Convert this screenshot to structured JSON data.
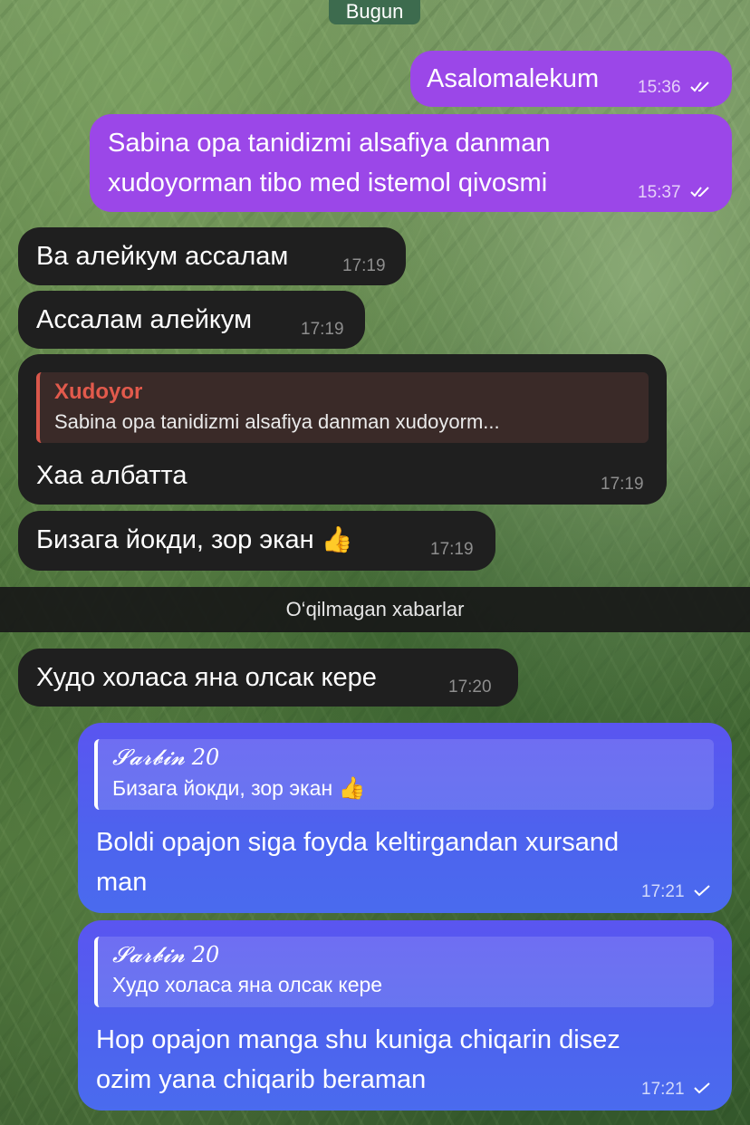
{
  "date_divider": "Bugun",
  "unread_divider": "O‘qilmagan xabarlar",
  "messages": [
    {
      "text": "Asalomalekum",
      "time": "15:36"
    },
    {
      "line1": "Sabina opa tanidizmi alsafiya danman",
      "line2": "xudoyorman tibo med istemol qivosmi",
      "time": "15:37"
    },
    {
      "text": "Ва алейкум ассалам",
      "time": "17:19"
    },
    {
      "text": "Ассалам алейкум",
      "time": "17:19"
    },
    {
      "reply_name": "Xudoyor",
      "reply_text": "Sabina opa tanidizmi alsafiya danman xudoyorm...",
      "text": "Хаа албатта",
      "time": "17:19"
    },
    {
      "text": "Бизага йокди, зор экан",
      "emoji": "👍",
      "time": "17:19"
    },
    {
      "text": "Худо холаса яна олсак кере",
      "time": "17:20"
    },
    {
      "reply_name": "𝓢𝓪𝓻𝓫𝓲𝓷 20",
      "reply_text": "Бизага йокди, зор экан",
      "reply_emoji": "👍",
      "line1": "Boldi opajon siga foyda keltirgandan xursand",
      "line2": "man",
      "time": "17:21"
    },
    {
      "reply_name": "𝓢𝓪𝓻𝓫𝓲𝓷 20",
      "reply_text": "Худо холаса яна олсак кере",
      "line1": "Hop opajon manga shu kuniga chiqarin disez",
      "line2": "ozim yana chiqarib beraman",
      "time": "17:21"
    }
  ],
  "icons": {
    "double_check": "double-check-icon",
    "single_check": "check-icon"
  }
}
